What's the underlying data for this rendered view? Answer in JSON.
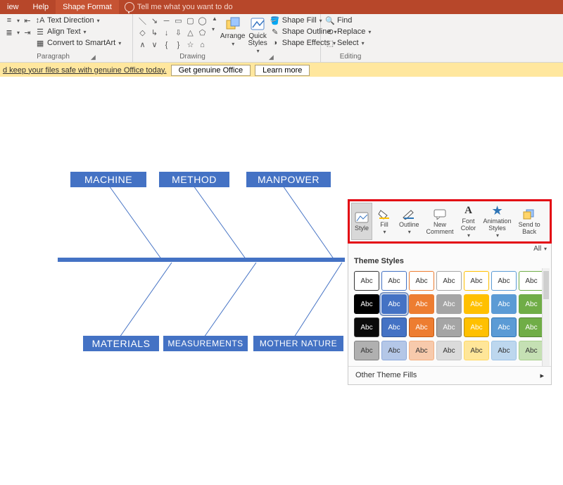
{
  "tabs": {
    "view": "iew",
    "help": "Help",
    "shape_format": "Shape Format",
    "tell_me": "Tell me what you want to do"
  },
  "ribbon": {
    "paragraph": {
      "label": "Paragraph",
      "text_direction": "Text Direction",
      "align_text": "Align Text",
      "convert_smartart": "Convert to SmartArt"
    },
    "drawing": {
      "label": "Drawing",
      "arrange": "Arrange",
      "quick_styles": "Quick\nStyles",
      "shape_fill": "Shape Fill",
      "shape_outline": "Shape Outline",
      "shape_effects": "Shape Effects"
    },
    "editing": {
      "label": "Editing",
      "find": "Find",
      "replace": "Replace",
      "select": "Select"
    }
  },
  "message_bar": {
    "text": "d keep your files safe with genuine Office today.",
    "btn_get": "Get genuine Office",
    "btn_learn": "Learn more"
  },
  "diagram": {
    "top": [
      "MACHINE",
      "METHOD",
      "MANPOWER"
    ],
    "bottom": [
      "MATERIALS",
      "MEASUREMENTS",
      "MOTHER NATURE"
    ]
  },
  "popup": {
    "tools": {
      "style": "Style",
      "fill": "Fill",
      "outline": "Outline",
      "new_comment": "New\nComment",
      "font_color": "Font\nColor",
      "animation": "Animation\nStyles",
      "send_back": "Send to\nBack"
    },
    "all": "All",
    "section": "Theme Styles",
    "other": "Other Theme Fills",
    "swatches": [
      {
        "bg": "#ffffff",
        "bd": "#333333",
        "fg": "#333333"
      },
      {
        "bg": "#ffffff",
        "bd": "#4472c4",
        "fg": "#333333"
      },
      {
        "bg": "#ffffff",
        "bd": "#ed7d31",
        "fg": "#333333"
      },
      {
        "bg": "#ffffff",
        "bd": "#a5a5a5",
        "fg": "#333333"
      },
      {
        "bg": "#ffffff",
        "bd": "#ffc000",
        "fg": "#333333"
      },
      {
        "bg": "#ffffff",
        "bd": "#5b9bd5",
        "fg": "#333333"
      },
      {
        "bg": "#ffffff",
        "bd": "#70ad47",
        "fg": "#333333"
      },
      {
        "bg": "#000000",
        "bd": "#000000",
        "fg": "#ffffff"
      },
      {
        "bg": "#4472c4",
        "bd": "#4472c4",
        "fg": "#ffffff",
        "selected": true
      },
      {
        "bg": "#ed7d31",
        "bd": "#ed7d31",
        "fg": "#ffffff"
      },
      {
        "bg": "#a5a5a5",
        "bd": "#a5a5a5",
        "fg": "#ffffff"
      },
      {
        "bg": "#ffc000",
        "bd": "#ffc000",
        "fg": "#ffffff"
      },
      {
        "bg": "#5b9bd5",
        "bd": "#5b9bd5",
        "fg": "#ffffff"
      },
      {
        "bg": "#70ad47",
        "bd": "#70ad47",
        "fg": "#ffffff"
      },
      {
        "bg": "#0a0a0a",
        "bd": "#3a3a3a",
        "fg": "#ffffff"
      },
      {
        "bg": "#4472c4",
        "bd": "#2f5597",
        "fg": "#ffffff"
      },
      {
        "bg": "#ed7d31",
        "bd": "#c55a11",
        "fg": "#ffffff"
      },
      {
        "bg": "#a5a5a5",
        "bd": "#7b7b7b",
        "fg": "#ffffff"
      },
      {
        "bg": "#ffc000",
        "bd": "#bf9000",
        "fg": "#ffffff"
      },
      {
        "bg": "#5b9bd5",
        "bd": "#2e75b6",
        "fg": "#ffffff"
      },
      {
        "bg": "#70ad47",
        "bd": "#548235",
        "fg": "#ffffff"
      },
      {
        "bg": "#b0b0b0",
        "bd": "#808080",
        "fg": "#333333"
      },
      {
        "bg": "#b4c7e7",
        "bd": "#8eaadb",
        "fg": "#333333"
      },
      {
        "bg": "#f7caac",
        "bd": "#f4b183",
        "fg": "#333333"
      },
      {
        "bg": "#dbdbdb",
        "bd": "#c9c9c9",
        "fg": "#333333"
      },
      {
        "bg": "#ffe699",
        "bd": "#ffd966",
        "fg": "#333333"
      },
      {
        "bg": "#bdd7ee",
        "bd": "#9dc3e6",
        "fg": "#333333"
      },
      {
        "bg": "#c5e0b4",
        "bd": "#a9d18e",
        "fg": "#333333"
      }
    ],
    "sample": "Abc"
  }
}
